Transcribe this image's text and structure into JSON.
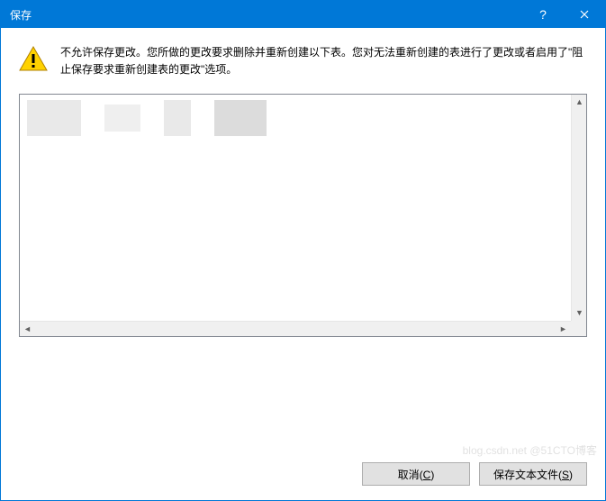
{
  "titlebar": {
    "title": "保存",
    "help_tooltip": "帮助",
    "close_tooltip": "关闭"
  },
  "message": {
    "text": "不允许保存更改。您所做的更改要求删除并重新创建以下表。您对无法重新创建的表进行了更改或者启用了\"阻止保存要求重新创建表的更改\"选项。"
  },
  "table_list": {
    "items": []
  },
  "buttons": {
    "cancel": {
      "label": "取消",
      "hotkey": "C"
    },
    "save_text_file": {
      "label": "保存文本文件",
      "hotkey": "S"
    }
  },
  "watermark": "blog.csdn.net @51CTO博客"
}
